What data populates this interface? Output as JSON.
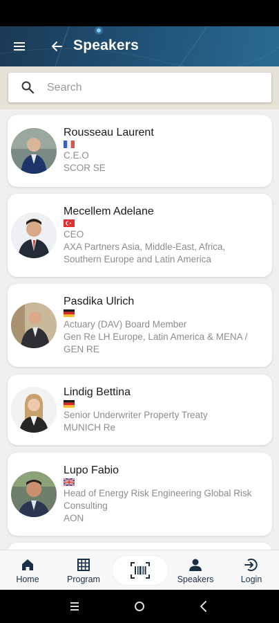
{
  "header": {
    "title": "Speakers"
  },
  "search": {
    "placeholder": "Search"
  },
  "speakers": [
    {
      "name": "Rousseau Laurent",
      "flag": "fr-flag-icon",
      "lines": [
        "C.E.O",
        "SCOR SE"
      ]
    },
    {
      "name": "Mecellem Adelane",
      "flag": "tr-flag-icon",
      "lines": [
        "CEO",
        "AXA Partners Asia, Middle-East, Africa,",
        "Southern Europe and Latin America"
      ]
    },
    {
      "name": "Pasdika Ulrich",
      "flag": "de-flag-icon",
      "lines": [
        "Actuary (DAV) Board Member",
        "Gen Re LH Europe, Latin America & MENA /",
        "GEN RE"
      ]
    },
    {
      "name": "Lindig Bettina",
      "flag": "de-flag-icon",
      "lines": [
        "Senior Underwriter Property Treaty",
        "MUNICH Re"
      ]
    },
    {
      "name": "Lupo Fabio",
      "flag": "gb-flag-icon",
      "lines": [
        "Head of Energy Risk Engineering Global Risk",
        "Consulting",
        "AON"
      ]
    }
  ],
  "nav": {
    "home": "Home",
    "program": "Program",
    "speakers": "Speakers",
    "login": "Login"
  },
  "colors": {
    "header": "#1f4f73",
    "nav_text": "#1b2f45",
    "muted_text": "#8c8c8c"
  }
}
